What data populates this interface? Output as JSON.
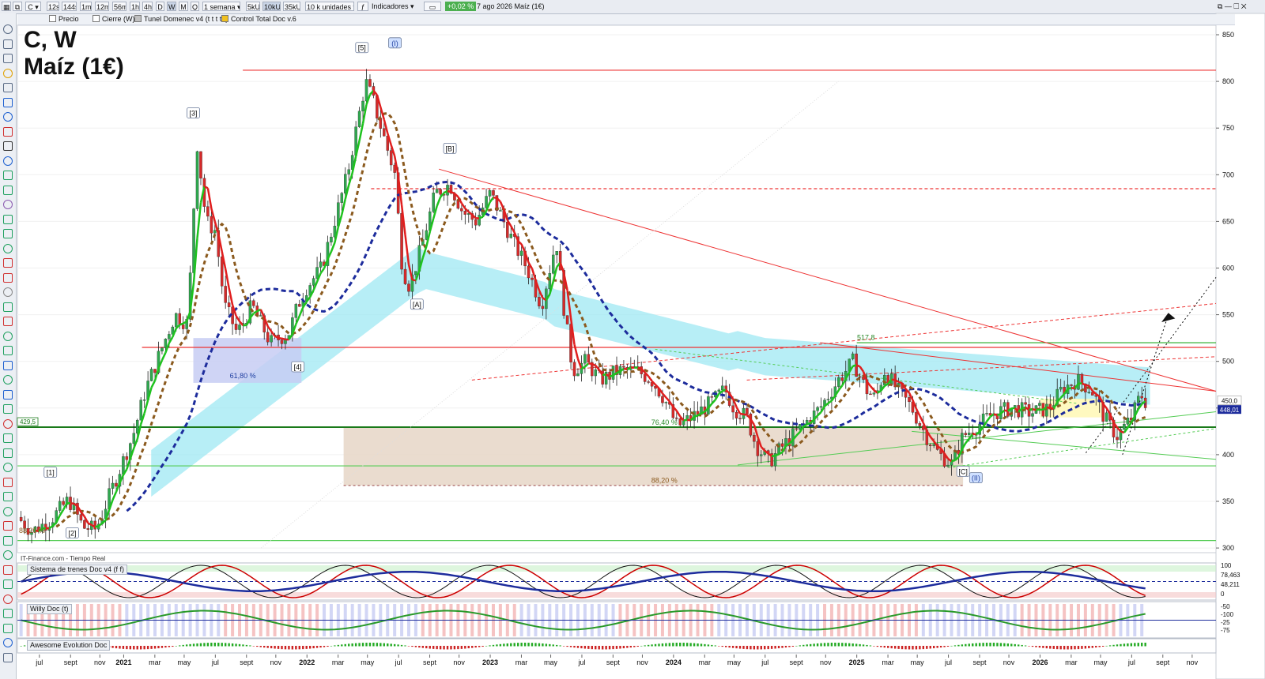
{
  "toolbar": {
    "symbol": "C",
    "intervals": [
      "12s",
      "144s",
      "1m",
      "12m",
      "56m",
      "1h",
      "4h",
      "D",
      "W",
      "M",
      "Q"
    ],
    "selected_interval": "W",
    "period": "1 semana",
    "unit_sizes": [
      "5kU",
      "10kU",
      "35kU"
    ],
    "selected_unit": "10kU",
    "units_select": "10 k unidades",
    "indicators_label": "Indicadores",
    "change": "+0,02 %",
    "date_instrument": "7 ago 2026  Maíz (1€)"
  },
  "layers": [
    "Precio",
    "Cierre (W)",
    "Tunel Domenec v4 (t t t t t)",
    "Control Total Doc v.6"
  ],
  "chart": {
    "title_line1": "C, W",
    "title_line2": "Maíz (1€)",
    "provider": "IT-Finance.com - Tiempo Real",
    "price_axis": [
      "850",
      "800",
      "750",
      "700",
      "650",
      "600",
      "550",
      "500",
      "450",
      "400",
      "350",
      "300"
    ],
    "price_tags": [
      {
        "text": "448,01",
        "color": "#ffffff",
        "bg": "#ffffff"
      },
      {
        "text": "450,0",
        "color": "#111111",
        "bg": "#ffffff"
      }
    ],
    "time_axis": [
      "jul",
      "sept",
      "nov",
      "2021",
      "mar",
      "may",
      "jul",
      "sept",
      "nov",
      "2022",
      "mar",
      "may",
      "jul",
      "sept",
      "nov",
      "2023",
      "mar",
      "may",
      "jul",
      "sept",
      "nov",
      "2024",
      "mar",
      "may",
      "jul",
      "sept",
      "nov",
      "2025",
      "mar",
      "may",
      "jul",
      "sept",
      "nov",
      "2026",
      "mar",
      "may",
      "jul",
      "sept",
      "nov"
    ],
    "wave_labels": [
      "[1]",
      "[2]",
      "[3]",
      "[4]",
      "[5]",
      "(I)",
      "[B]",
      "[A]",
      "[C]",
      "(II)"
    ],
    "fib_labels": [
      "61,80 %",
      "76,40 %",
      "88,20 %",
      "88,20 %",
      "517,8"
    ],
    "left_level": "429,5"
  },
  "panels": [
    {
      "label": "Sistema de trenes Doc v4 (f f)",
      "axis": [
        "100",
        "78,463",
        "48,211",
        "0"
      ]
    },
    {
      "label": "Willy Doc (t)",
      "axis": [
        "-50",
        "-100",
        "-25",
        "-75"
      ]
    },
    {
      "label": "Awesome Evolution Doc",
      "axis": []
    }
  ],
  "colors": {
    "up": "#2fa84f",
    "down": "#d62a2a",
    "wick": "#222222",
    "green_ma": "#1ec21e",
    "red_ma": "#e01e1e",
    "blue_ma": "#1d2c9c",
    "brown_ma": "#8b5a1e",
    "cloud": "#9fe8f3",
    "fib_box": "#e6d6c7",
    "fib_blue": "#c7ccf3"
  }
}
